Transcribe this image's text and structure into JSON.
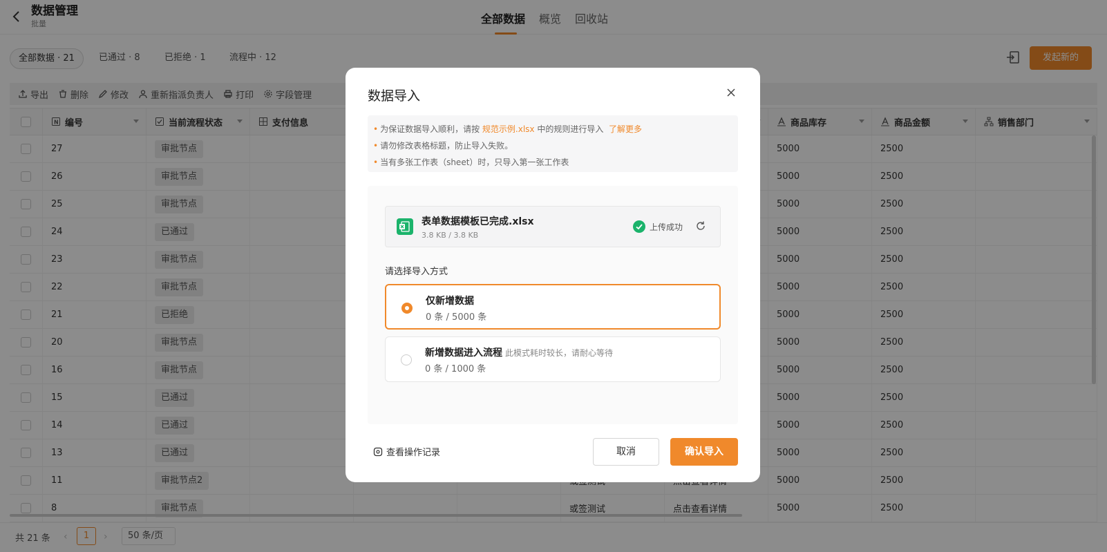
{
  "header": {
    "title": "数据管理",
    "subtitle": "批量",
    "tabs": [
      "全部数据",
      "概览",
      "回收站"
    ]
  },
  "filters": {
    "pills": [
      "全部数据 · 21",
      "已通过 · 8",
      "已拒绝 · 1",
      "流程中 · 12"
    ],
    "launch_label": "发起新的"
  },
  "toolbar": {
    "export": "导出",
    "delete": "删除",
    "edit": "修改",
    "reassign": "重新指派负责人",
    "print": "打印",
    "fields": "字段管理"
  },
  "table": {
    "headers": [
      "编号",
      "当前流程状态",
      "支付信息",
      "",
      "",
      "",
      "",
      "商品库存",
      "商品金额",
      "销售部门"
    ],
    "rows": [
      {
        "id": "27",
        "status": "审批节点",
        "c3": "",
        "c4": "",
        "stock": "5000",
        "amount": "2500"
      },
      {
        "id": "26",
        "status": "审批节点",
        "c3": "",
        "c4": "",
        "stock": "5000",
        "amount": "2500"
      },
      {
        "id": "25",
        "status": "审批节点",
        "c3": "",
        "c4": "",
        "stock": "5000",
        "amount": "2500"
      },
      {
        "id": "24",
        "status": "已通过",
        "c3": "",
        "c4": "",
        "stock": "5000",
        "amount": "2500"
      },
      {
        "id": "23",
        "status": "审批节点",
        "c3": "",
        "c4": "",
        "stock": "5000",
        "amount": "2500"
      },
      {
        "id": "22",
        "status": "审批节点",
        "c3": "",
        "c4": "",
        "stock": "5000",
        "amount": "2500"
      },
      {
        "id": "21",
        "status": "已拒绝",
        "c3": "",
        "c4": "",
        "stock": "5000",
        "amount": "2500"
      },
      {
        "id": "20",
        "status": "审批节点",
        "c3": "",
        "c4": "",
        "stock": "5000",
        "amount": "2500"
      },
      {
        "id": "16",
        "status": "审批节点",
        "c3": "",
        "c4": "",
        "stock": "5000",
        "amount": "2500"
      },
      {
        "id": "15",
        "status": "已通过",
        "c3": "",
        "c4": "",
        "stock": "5000",
        "amount": "2500"
      },
      {
        "id": "14",
        "status": "已通过",
        "c3": "",
        "c4": "",
        "stock": "5000",
        "amount": "2500"
      },
      {
        "id": "13",
        "status": "已通过",
        "c3": "",
        "c4": "",
        "stock": "5000",
        "amount": "2500"
      },
      {
        "id": "11",
        "status": "审批节点2",
        "c3": "或签测试",
        "c4": "点击查看详情",
        "stock": "5000",
        "amount": "2500"
      },
      {
        "id": "8",
        "status": "审批节点",
        "c3": "或签测试",
        "c4": "点击查看详情",
        "stock": "5000",
        "amount": "2500"
      }
    ]
  },
  "pagination": {
    "total": "共 21 条",
    "prev": "‹",
    "current": "1",
    "next": "›",
    "page_size": "50 条/页"
  },
  "modal": {
    "title": "数据导入",
    "notice": {
      "line1_pre": "为保证数据导入顺利，请按 ",
      "line1_link": "规范示例.xlsx",
      "line1_post": " 中的规则进行导入",
      "line1_more": "了解更多",
      "line2": "请勿修改表格标题，防止导入失败。",
      "line3": "当有多张工作表（sheet）时，只导入第一张工作表"
    },
    "file": {
      "name": "表单数据模板已完成.xlsx",
      "size": "3.8 KB / 3.8 KB",
      "status": "上传成功"
    },
    "mode_label": "请选择导入方式",
    "options": [
      {
        "title": "仅新增数据",
        "note": "",
        "sub": "0 条 / 5000 条"
      },
      {
        "title": "新增数据进入流程",
        "note": "此模式耗时较长，请耐心等待",
        "sub": "0 条 / 1000 条"
      }
    ],
    "log_label": "查看操作记录",
    "cancel_label": "取消",
    "confirm_label": "确认导入"
  },
  "colors": {
    "accent": "#f0892b",
    "success": "#1bb36b"
  }
}
